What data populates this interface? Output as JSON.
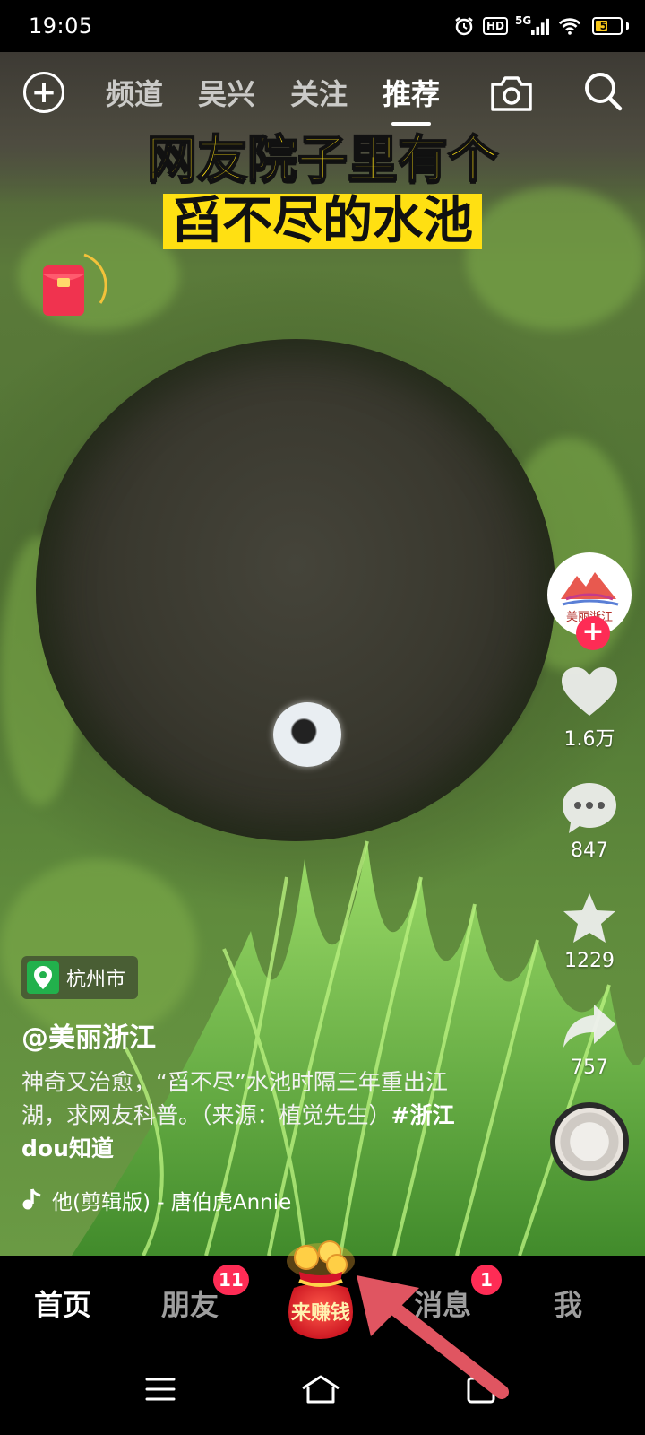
{
  "status_bar": {
    "time": "19:05",
    "hd": "HD",
    "network": "5G",
    "battery_level": "51",
    "icons": [
      "alarm-icon",
      "hd-icon",
      "signal-icon",
      "wifi-icon",
      "battery-icon"
    ]
  },
  "top_nav": {
    "add_icon": "plus-circle-icon",
    "tabs": [
      {
        "label": "频道",
        "active": false
      },
      {
        "label": "吴兴",
        "active": false
      },
      {
        "label": "关注",
        "active": false
      },
      {
        "label": "推荐",
        "active": true
      }
    ],
    "camera_icon": "camera-icon",
    "search_icon": "search-icon"
  },
  "video": {
    "caption_line1": "网友院子里有个",
    "caption_line2": "舀不尽的水池"
  },
  "red_envelope": {
    "icon": "red-envelope-icon"
  },
  "rail": {
    "avatar_text": "美丽浙江",
    "follow_icon": "plus-icon",
    "like_count": "1.6万",
    "comment_count": "847",
    "favorite_count": "1229",
    "share_count": "757"
  },
  "info": {
    "location": "杭州市",
    "author": "@美丽浙江",
    "description": "神奇又治愈，“舀不尽”水池时隔三年重出江湖，求网友科普。（来源：植觉先生）",
    "hashtag": "#浙江dou知道",
    "music": "他(剪辑版) - 唐伯虎Annie"
  },
  "tabbar": {
    "home": "首页",
    "friends": "朋友",
    "friends_badge": "11",
    "earn": "来赚钱",
    "messages": "消息",
    "messages_badge": "1",
    "me": "我"
  },
  "colors": {
    "accent": "#fe2c55",
    "caption_yellow": "#ffe012",
    "location_green": "#22b14c",
    "annotation_red": "#e05561"
  }
}
